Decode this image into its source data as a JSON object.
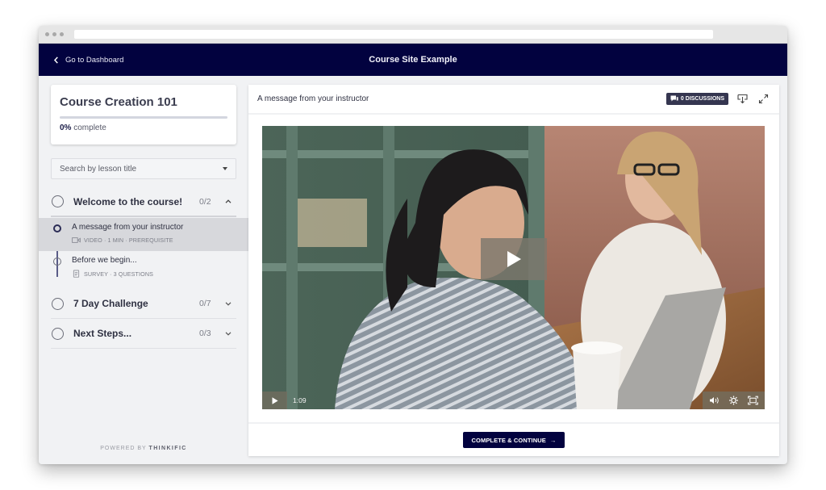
{
  "browser": {
    "url": ""
  },
  "topbar": {
    "back_label": "Go to Dashboard",
    "site_title": "Course Site Example",
    "bg_color": "#02023f"
  },
  "sidebar": {
    "course": {
      "title": "Course Creation 101",
      "progress_percent": 0,
      "progress_value": "0%",
      "progress_suffix": "complete"
    },
    "search": {
      "placeholder": "Search by lesson title",
      "value": ""
    },
    "chapters": [
      {
        "title": "Welcome to the course!",
        "count": "0/2",
        "expanded": true,
        "lessons": [
          {
            "title": "A message from your instructor",
            "type_icon": "video-icon",
            "meta": "VIDEO · 1 MIN · PREREQUISITE",
            "active": true
          },
          {
            "title": "Before we begin...",
            "type_icon": "survey-icon",
            "meta": "SURVEY · 3 QUESTIONS",
            "active": false
          }
        ]
      },
      {
        "title": "7 Day Challenge",
        "count": "0/7",
        "expanded": false
      },
      {
        "title": "Next Steps...",
        "count": "0/3",
        "expanded": false
      }
    ],
    "powered_by_prefix": "POWERED BY",
    "powered_by_brand": "THINKIFIC"
  },
  "main": {
    "lesson_title": "A message from your instructor",
    "discussions_label": "0 DISCUSSIONS",
    "video": {
      "time": "1:09",
      "play_icon": "play-icon",
      "volume_icon": "volume-icon",
      "settings_icon": "gear-icon",
      "fullscreen_icon": "fullscreen-icon"
    },
    "complete_button_label": "COMPLETE & CONTINUE",
    "complete_button_arrow": "→"
  }
}
